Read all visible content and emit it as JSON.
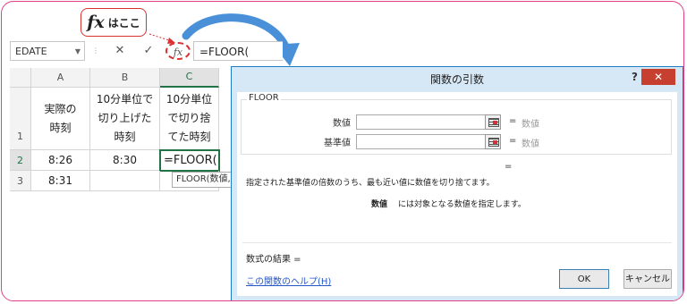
{
  "callout": {
    "fx": "fx",
    "text": "はここ"
  },
  "formula_bar": {
    "name_box": "EDATE",
    "cancel_symbol": "✕",
    "enter_symbol": "✓",
    "fx_symbol": "fx",
    "formula": "=FLOOR("
  },
  "sheet": {
    "columns": [
      "A",
      "B",
      "C"
    ],
    "rows": [
      "1",
      "2",
      "3"
    ],
    "row1": {
      "a": [
        "実際の",
        "時刻"
      ],
      "b": [
        "10分単位で",
        "切り上げた",
        "時刻"
      ],
      "c": [
        "10分単位",
        "で切り捨",
        "てた時刻"
      ]
    },
    "row2": {
      "a": "8:26",
      "b": "8:30",
      "c": "=FLOOR("
    },
    "row3": {
      "a": "8:31",
      "b": "",
      "c": ""
    },
    "tooltip": "FLOOR(数値,"
  },
  "dialog": {
    "title": "関数の引数",
    "help_symbol": "?",
    "close_symbol": "✕",
    "function_name": "FLOOR",
    "arg1_label": "数値",
    "arg1_hint": "数値",
    "arg2_label": "基準値",
    "arg2_hint": "数値",
    "equals": "=",
    "description": "指定された基準値の倍数のうち、最も近い値に数値を切り捨てます。",
    "arg_description_name": "数値",
    "arg_description": "には対象となる数値を指定します。",
    "result_label": "数式の結果 =",
    "help_link": "この関数のヘルプ(H)",
    "ok_label": "OK",
    "cancel_label": "キャンセル"
  },
  "colors": {
    "frame": "#e0408a",
    "accent_red": "#d93030",
    "excel_green": "#217346",
    "dialog_border": "#1f7dc4",
    "arrow": "#4a90d9"
  }
}
